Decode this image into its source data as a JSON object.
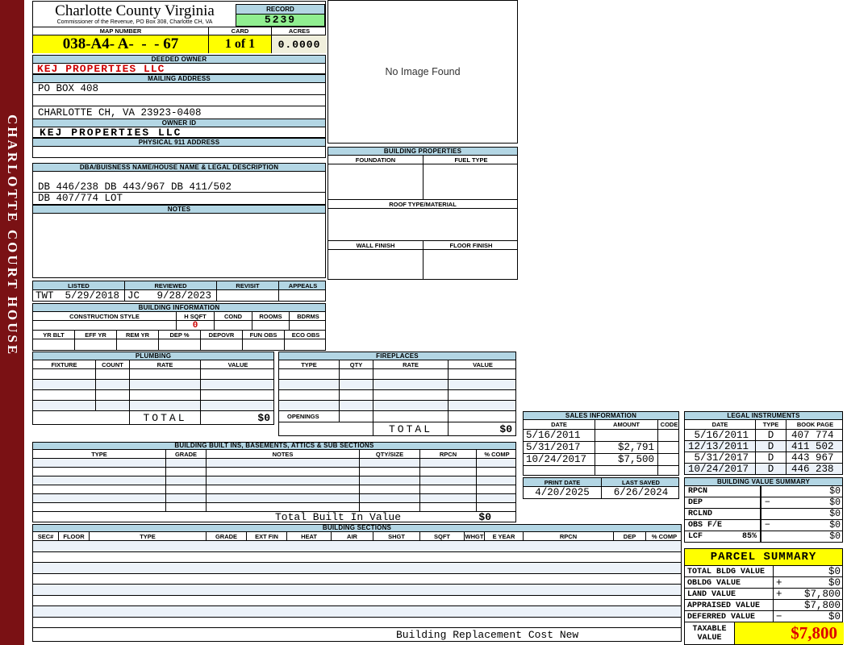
{
  "colors": {
    "maroon": "#7A1114",
    "header_blue": "#B3D6E4",
    "record_green": "#90EE90",
    "highlight_yellow": "#FFFF00",
    "acres_cream": "#F0EFDC",
    "alert_red": "#CC0000",
    "taxable_red": "#DD0000",
    "stripe_blue": "#ECF2F9"
  },
  "sidebar": {
    "title": "CHARLOTTE COURT HOUSE"
  },
  "header": {
    "county": "Charlotte County Virginia",
    "commissioner": "Commissioner of the Revenue, PO Box 308, Charlotte CH, VA",
    "record_label": "RECORD",
    "record_value": "5239",
    "map_label": "MAP NUMBER",
    "map_value": "038-A4- A-  -  - 67",
    "card_label": "CARD",
    "card_value": "1 of 1",
    "acres_label": "ACRES",
    "acres_value": "0.0000"
  },
  "owner": {
    "deeded_label": "DEEDED OWNER",
    "deeded_value": "KEJ PROPERTIES LLC",
    "mailing_label": "MAILING ADDRESS",
    "mailing_line1": "PO BOX 408",
    "mailing_line2": "",
    "mailing_line3": "CHARLOTTE CH, VA 23923-0408",
    "owner_id_label": "OWNER ID",
    "owner_id_value": "KEJ PROPERTIES LLC",
    "physical_label": "PHYSICAL 911 ADDRESS",
    "physical_value": ""
  },
  "legal_desc": {
    "label": "DBA/BUISNESS NAME/HOUSE NAME & LEGAL DESCRIPTION",
    "line1": "DB 446/238 DB 443/967 DB 411/502",
    "line2": "DB 407/774 LOT",
    "notes_label": "NOTES",
    "notes_value": ""
  },
  "visits": {
    "headers": [
      "LISTED",
      "REVIEWED",
      "REVISIT",
      "APPEALS"
    ],
    "listed_by": "TWT",
    "listed_date": "5/29/2018",
    "reviewed_by": "JC",
    "reviewed_date": "9/28/2023",
    "revisit": "",
    "appeals": ""
  },
  "building_info": {
    "title": "BUILDING INFORMATION",
    "row1_headers": [
      "CONSTRUCTION STYLE",
      "H SQFT",
      "COND",
      "ROOMS",
      "BDRMS"
    ],
    "h_sqft": "0",
    "row2_headers": [
      "YR BLT",
      "EFF YR",
      "REM YR",
      "DEP %",
      "DEPOVR",
      "FUN OBS",
      "ECO OBS"
    ]
  },
  "plumbing": {
    "title": "PLUMBING",
    "headers": [
      "FIXTURE",
      "COUNT",
      "RATE",
      "VALUE"
    ],
    "total_label": "TOTAL",
    "total_value": "$0"
  },
  "fireplaces": {
    "title": "FIREPLACES",
    "headers": [
      "TYPE",
      "QTY",
      "RATE",
      "VALUE"
    ],
    "openings_label": "OPENINGS",
    "total_label": "TOTAL",
    "total_value": "$0"
  },
  "built_ins": {
    "title": "BUILDING BUILT INS, BASEMENTS, ATTICS & SUB SECTIONS",
    "headers": [
      "TYPE",
      "GRADE",
      "NOTES",
      "QTY/SIZE",
      "RPCN",
      "% COMP"
    ],
    "total_label": "Total Built In Value",
    "total_value": "$0"
  },
  "building_sections": {
    "title": "BUILDING SECTIONS",
    "headers": [
      "SEC#",
      "FLOOR",
      "TYPE",
      "GRADE",
      "EXT FIN",
      "HEAT",
      "AIR",
      "SHGT",
      "SQFT",
      "WHGT",
      "E YEAR",
      "RPCN",
      "DEP",
      "% COMP"
    ],
    "footer": "Building Replacement Cost New"
  },
  "image_panel": {
    "message": "No Image Found"
  },
  "building_properties": {
    "title": "BUILDING PROPERTIES",
    "foundation_label": "FOUNDATION",
    "fuel_label": "FUEL TYPE",
    "roof_label": "ROOF TYPE/MATERIAL",
    "wall_label": "WALL FINISH",
    "floor_label": "FLOOR FINISH"
  },
  "sales": {
    "title": "SALES INFORMATION",
    "headers": [
      "DATE",
      "AMOUNT",
      "CODE"
    ],
    "rows": [
      {
        "date": "5/16/2011",
        "amount": "",
        "code": ""
      },
      {
        "date": "5/31/2017",
        "amount": "$2,791",
        "code": ""
      },
      {
        "date": "10/24/2017",
        "amount": "$7,500",
        "code": ""
      }
    ]
  },
  "print_info": {
    "print_date_label": "PRINT DATE",
    "print_date": "4/20/2025",
    "last_saved_label": "LAST SAVED",
    "last_saved": "6/26/2024"
  },
  "legal_instruments": {
    "title": "LEGAL INSTRUMENTS",
    "headers": [
      "DATE",
      "TYPE",
      "BOOK PAGE"
    ],
    "rows": [
      {
        "date": "5/16/2011",
        "type": "D",
        "book_page": "407 774"
      },
      {
        "date": "12/13/2011",
        "type": "D",
        "book_page": "411 502"
      },
      {
        "date": "5/31/2017",
        "type": "D",
        "book_page": "443 967"
      },
      {
        "date": "10/24/2017",
        "type": "D",
        "book_page": "446 238"
      }
    ]
  },
  "value_summary": {
    "title": "BUILDING VALUE SUMMARY",
    "rows": [
      {
        "label": "RPCN",
        "pct": "",
        "op": "",
        "value": "$0"
      },
      {
        "label": "DEP",
        "pct": "",
        "op": "−",
        "value": "$0"
      },
      {
        "label": "RCLND",
        "pct": "",
        "op": "",
        "value": "$0"
      },
      {
        "label": "OBS F/E",
        "pct": "",
        "op": "−",
        "value": "$0"
      },
      {
        "label": "LCF",
        "pct": "85%",
        "op": "",
        "value": "$0"
      }
    ]
  },
  "parcel_summary": {
    "title": "PARCEL SUMMARY",
    "rows": [
      {
        "label": "TOTAL BLDG VALUE",
        "op": "",
        "value": "$0"
      },
      {
        "label": "OBLDG VALUE",
        "op": "+",
        "value": "$0"
      },
      {
        "label": "LAND VALUE",
        "op": "+",
        "value": "$7,800"
      },
      {
        "label": "APPRAISED VALUE",
        "op": "",
        "value": "$7,800"
      },
      {
        "label": "DEFERRED VALUE",
        "op": "−",
        "value": "$0"
      }
    ],
    "taxable_label": "TAXABLE VALUE",
    "taxable_value": "$7,800"
  }
}
